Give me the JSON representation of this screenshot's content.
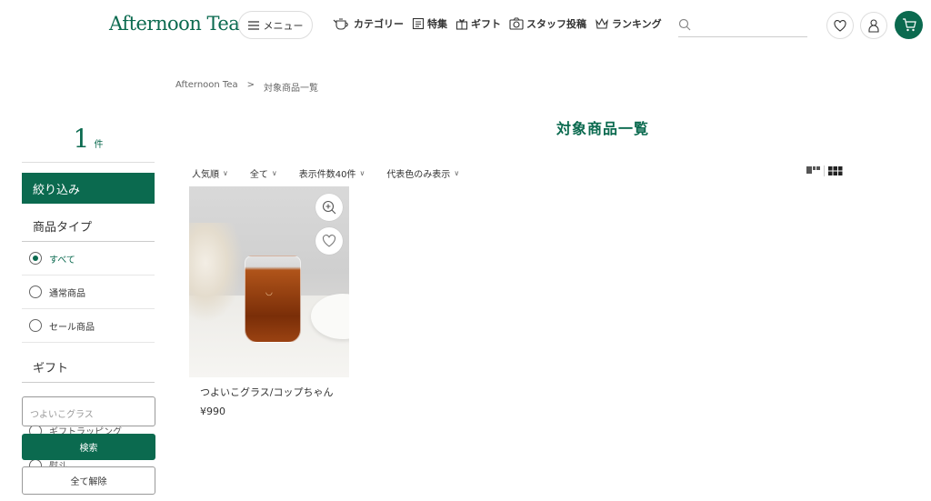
{
  "header": {
    "logo": "Afternoon Tea",
    "menu_label": "メニュー",
    "nav": [
      {
        "label": "カテゴリー",
        "icon": "teapot-icon"
      },
      {
        "label": "特集",
        "icon": "document-icon"
      },
      {
        "label": "ギフト",
        "icon": "gift-icon"
      },
      {
        "label": "スタッフ投稿",
        "icon": "camera-icon"
      },
      {
        "label": "ランキング",
        "icon": "crown-icon"
      }
    ],
    "search_placeholder": "",
    "accent_color": "#0b6a4f"
  },
  "breadcrumb": {
    "home": "Afternoon Tea",
    "separator": ">",
    "current": "対象商品一覧"
  },
  "page_title": "対象商品一覧",
  "sidebar": {
    "count_number": "1",
    "count_unit": "件",
    "filter_title": "絞り込み",
    "product_type_title": "商品タイプ",
    "product_types": [
      {
        "label": "すべて",
        "selected": true
      },
      {
        "label": "通常商品",
        "selected": false
      },
      {
        "label": "セール商品",
        "selected": false
      }
    ],
    "gift_title": "ギフト",
    "gift_options": [
      {
        "label": "ギフトラッピング"
      },
      {
        "label": "熨斗"
      }
    ],
    "keyword_value": "つよいこグラス",
    "search_button": "検索",
    "clear_button": "全て解除"
  },
  "sortbar": {
    "sort": "人気順",
    "filter": "全て",
    "per_page": "表示件数40件",
    "color_mode": "代表色のみ表示"
  },
  "products": [
    {
      "name": "つよいこグラス/コップちゃん",
      "price": "¥990"
    }
  ]
}
